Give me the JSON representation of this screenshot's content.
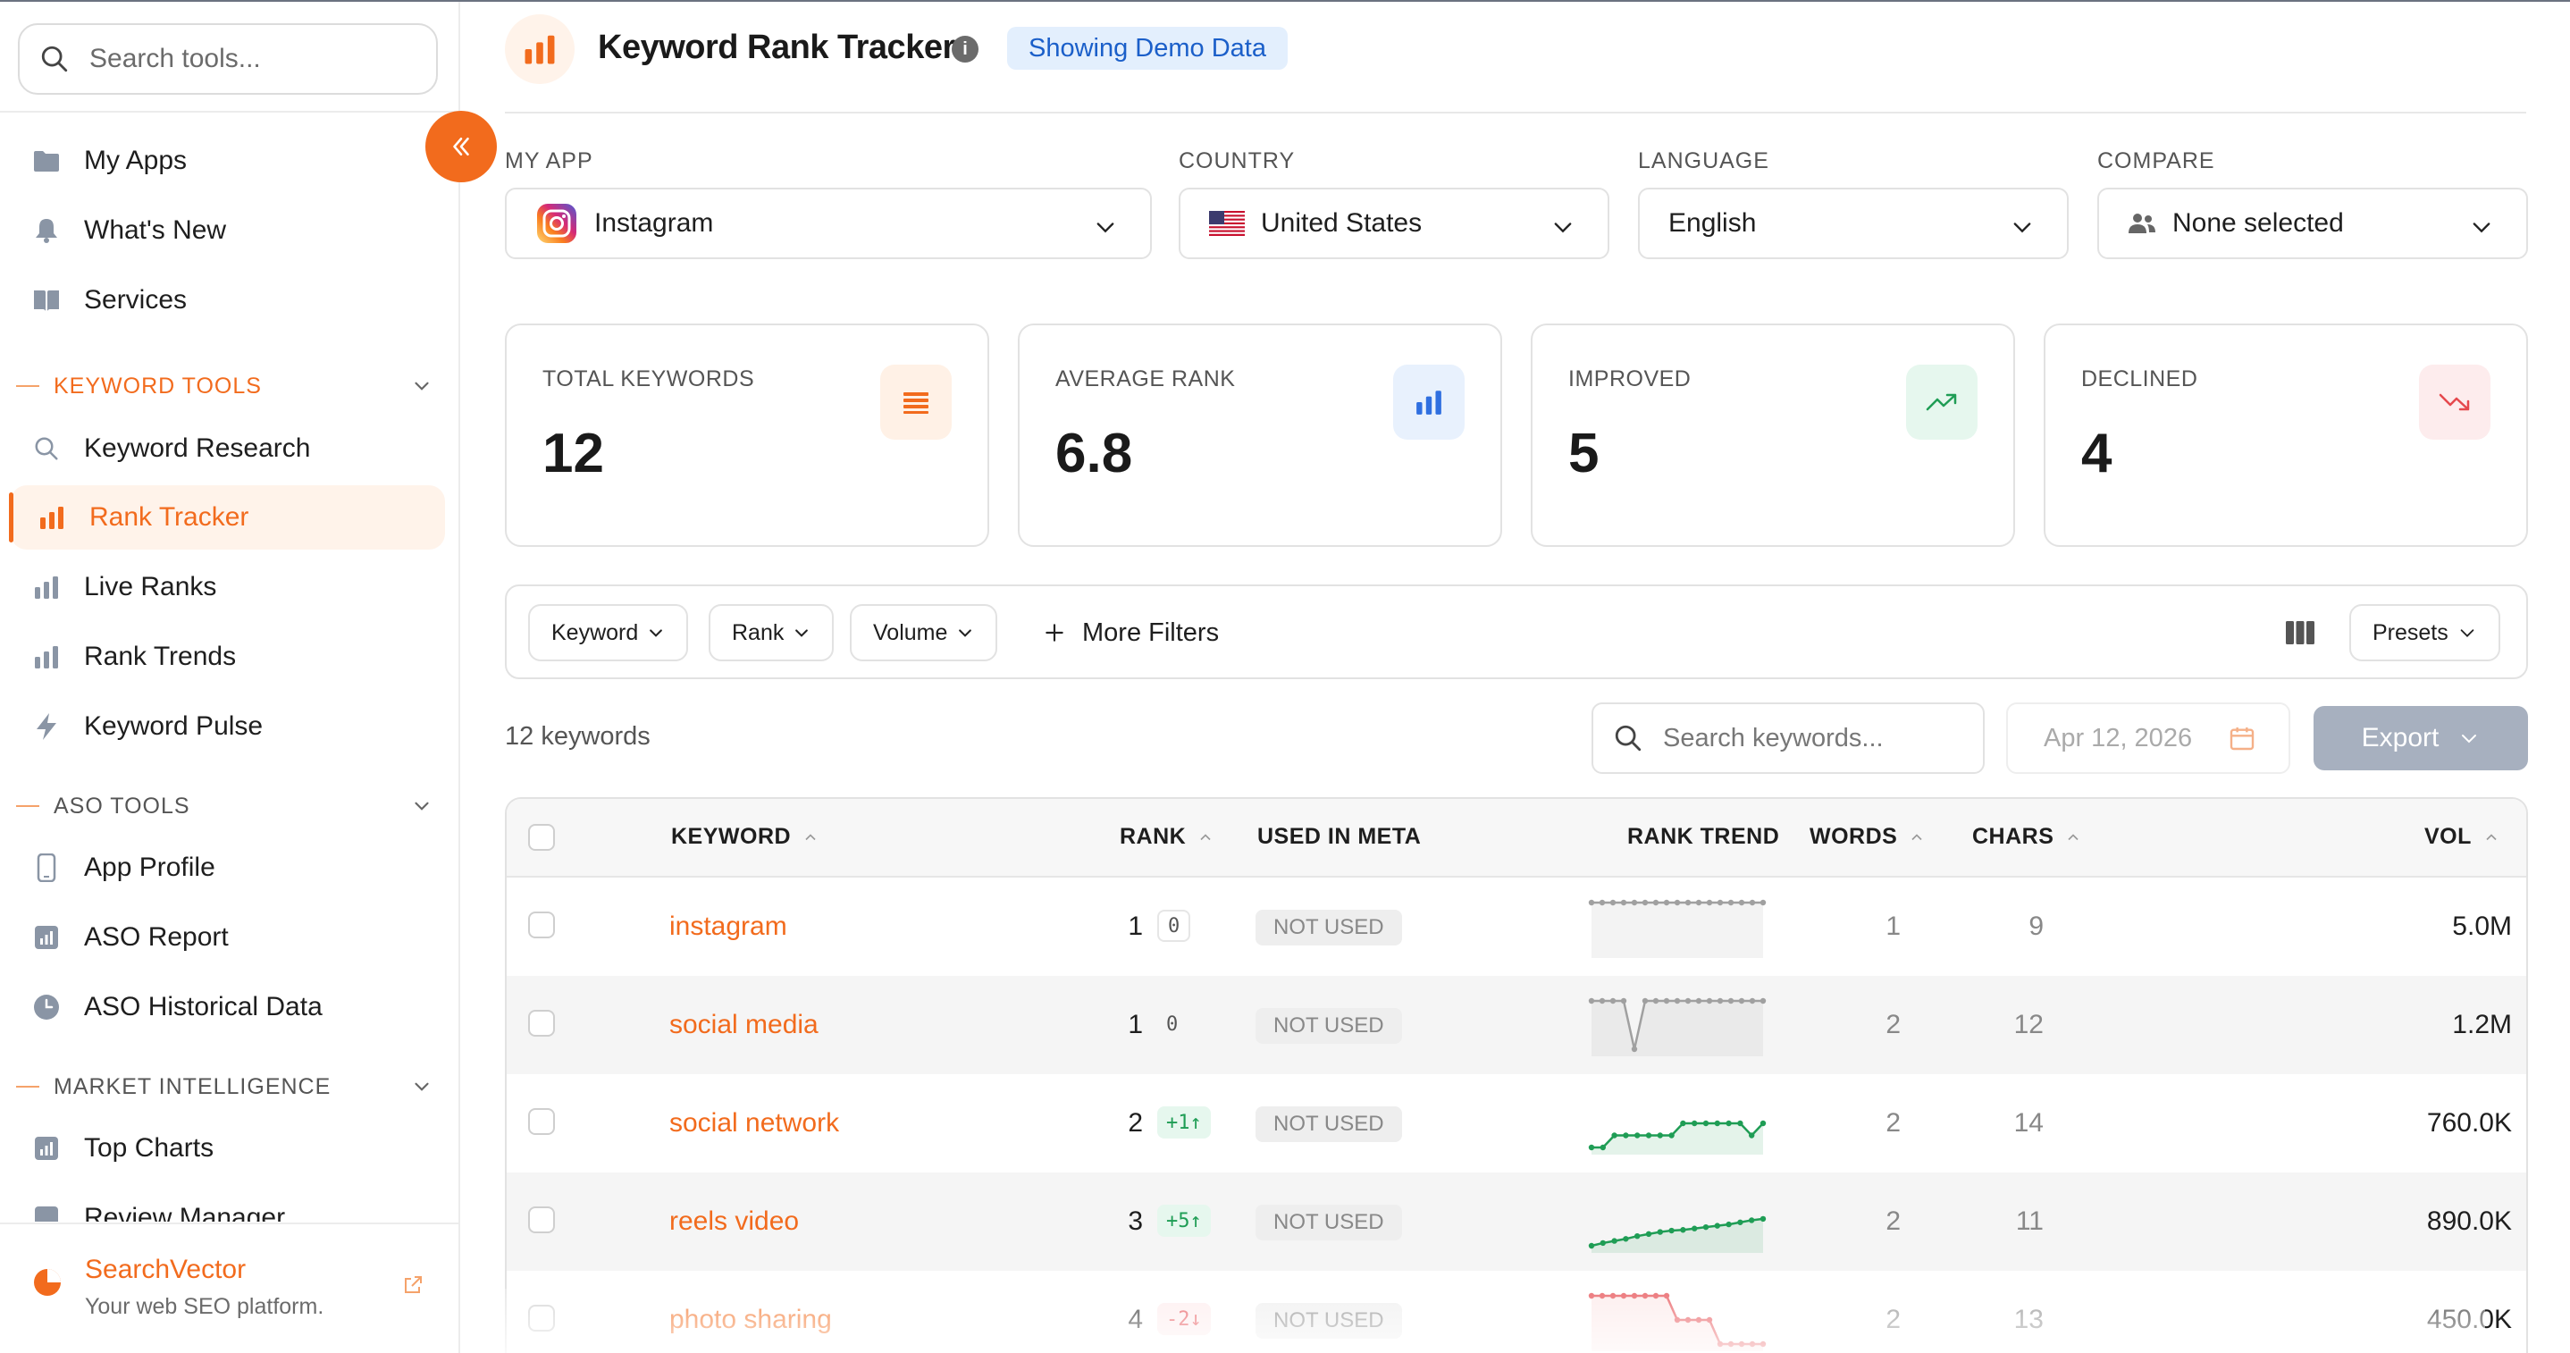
{
  "sidebar": {
    "search_placeholder": "Search tools...",
    "top_items": [
      {
        "label": "My Apps",
        "icon": "folder-icon"
      },
      {
        "label": "What's New",
        "icon": "bell-icon"
      },
      {
        "label": "Services",
        "icon": "book-icon"
      }
    ],
    "sections": [
      {
        "label": "KEYWORD TOOLS",
        "items": [
          {
            "label": "Keyword Research",
            "icon": "search-icon"
          },
          {
            "label": "Rank Tracker",
            "icon": "bar-chart-icon",
            "active": true
          },
          {
            "label": "Live Ranks",
            "icon": "bar-chart-icon"
          },
          {
            "label": "Rank Trends",
            "icon": "bar-chart-icon"
          },
          {
            "label": "Keyword Pulse",
            "icon": "lightning-icon"
          }
        ]
      },
      {
        "label": "ASO TOOLS",
        "items": [
          {
            "label": "App Profile",
            "icon": "phone-icon"
          },
          {
            "label": "ASO Report",
            "icon": "report-icon"
          },
          {
            "label": "ASO Historical Data",
            "icon": "clock-icon"
          }
        ]
      },
      {
        "label": "MARKET INTELLIGENCE",
        "items": [
          {
            "label": "Top Charts",
            "icon": "chart-box-icon"
          },
          {
            "label": "Review Manager",
            "icon": "review-icon"
          }
        ]
      }
    ],
    "brand": {
      "name": "SearchVector",
      "tagline": "Your web SEO platform."
    }
  },
  "header": {
    "title": "Keyword Rank Tracker",
    "info_glyph": "i",
    "badge": "Showing Demo Data"
  },
  "filters": {
    "app": {
      "label": "MY APP",
      "value": "Instagram"
    },
    "country": {
      "label": "COUNTRY",
      "value": "United States"
    },
    "language": {
      "label": "LANGUAGE",
      "value": "English"
    },
    "compare": {
      "label": "COMPARE",
      "value": "None selected"
    }
  },
  "stats": [
    {
      "label": "TOTAL KEYWORDS",
      "value": "12",
      "icon": "list-icon",
      "bg": "#fff1e6",
      "fg": "#f26b1d"
    },
    {
      "label": "AVERAGE RANK",
      "value": "6.8",
      "icon": "bar-chart-icon",
      "bg": "#e8f1fd",
      "fg": "#2f6fe0"
    },
    {
      "label": "IMPROVED",
      "value": "5",
      "icon": "trend-up-icon",
      "bg": "#e6f7ee",
      "fg": "#1f9d55"
    },
    {
      "label": "DECLINED",
      "value": "4",
      "icon": "trend-down-icon",
      "bg": "#fdeced",
      "fg": "#e5484d"
    }
  ],
  "filter_bar": {
    "pills": [
      "Keyword",
      "Rank",
      "Volume"
    ],
    "more_filters": "More Filters",
    "presets": "Presets"
  },
  "toolbar": {
    "count_text": "12 keywords",
    "search_placeholder": "Search keywords...",
    "date": "Apr 12, 2026",
    "export": "Export"
  },
  "table": {
    "columns": {
      "keyword": "KEYWORD",
      "rank": "RANK",
      "meta": "USED IN META",
      "trend": "RANK TREND",
      "words": "WORDS",
      "chars": "CHARS",
      "vol": "VOL"
    },
    "rows": [
      {
        "keyword": "instagram",
        "rank": "1",
        "change": "0",
        "change_kind": "zero-box",
        "meta": "NOT USED",
        "words": "1",
        "chars": "9",
        "vol": "5.0M",
        "trend": [
          1,
          1,
          1,
          1,
          1,
          1,
          1,
          1,
          1,
          1,
          1,
          1,
          1,
          1,
          1,
          1,
          1
        ],
        "trend_color": "#a0a0a0"
      },
      {
        "keyword": "social media",
        "rank": "1",
        "change": "0",
        "change_kind": "zero",
        "meta": "NOT USED",
        "words": "2",
        "chars": "12",
        "vol": "1.2M",
        "trend": [
          1,
          1,
          1,
          1,
          3,
          1,
          1,
          1,
          1,
          1,
          1,
          1,
          1,
          1,
          1,
          1,
          1
        ],
        "trend_color": "#a0a0a0"
      },
      {
        "keyword": "social network",
        "rank": "2",
        "change": "+1↑",
        "change_kind": "up",
        "meta": "NOT USED",
        "words": "2",
        "chars": "14",
        "vol": "760.0K",
        "trend": [
          5,
          5,
          4,
          4,
          4,
          4,
          4,
          4,
          3,
          3,
          3,
          3,
          3,
          3,
          4,
          3
        ],
        "trend_color": "#1f9d55"
      },
      {
        "keyword": "reels video",
        "rank": "3",
        "change": "+5↑",
        "change_kind": "up",
        "meta": "NOT USED",
        "words": "2",
        "chars": "11",
        "vol": "890.0K",
        "trend": [
          8,
          7.6,
          7.3,
          7,
          6.6,
          6.3,
          6,
          5.8,
          5.7,
          5.5,
          5.3,
          5.1,
          4.9,
          4.6,
          4.3,
          4.1
        ],
        "trend_color": "#1f9d55"
      },
      {
        "keyword": "photo sharing",
        "rank": "4",
        "change": "-2↓",
        "change_kind": "down",
        "meta": "NOT USED",
        "words": "2",
        "chars": "13",
        "vol": "450.0K",
        "trend": [
          1,
          1,
          1,
          1,
          1,
          1,
          1,
          1,
          2,
          2,
          2,
          2,
          3,
          3,
          3,
          3,
          3
        ],
        "trend_color": "#e5484d"
      }
    ]
  }
}
